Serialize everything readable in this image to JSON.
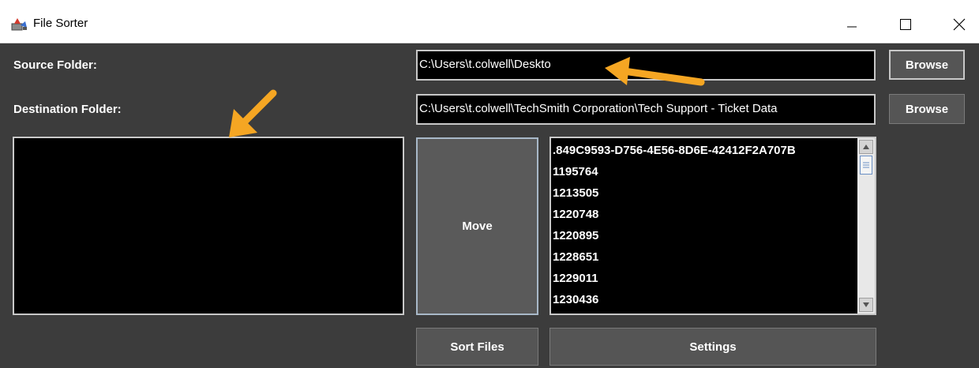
{
  "window": {
    "title": "File Sorter"
  },
  "form": {
    "source_label": "Source Folder:",
    "source_value": "C:\\Users\\t.colwell\\Deskto",
    "destination_label": "Destination Folder:",
    "destination_value": "C:\\Users\\t.colwell\\TechSmith Corporation\\Tech Support - Ticket Data",
    "browse_source_label": "Browse",
    "browse_destination_label": "Browse"
  },
  "actions": {
    "move_label": "Move",
    "sort_label": "Sort Files",
    "settings_label": "Settings"
  },
  "file_list": {
    "items": [
      ".849C9593-D756-4E56-8D6E-42412F2A707B",
      "1195764",
      "1213505",
      "1220748",
      "1220895",
      "1228651",
      "1229011",
      "1230436"
    ]
  },
  "colors": {
    "window_bg": "#3c3c3c",
    "field_bg": "#000000",
    "annotation_arrow": "#f5a623"
  },
  "icons": {
    "app": "file-sorter-icon",
    "minimize": "minimize-icon",
    "maximize": "maximize-icon",
    "close": "close-icon"
  }
}
